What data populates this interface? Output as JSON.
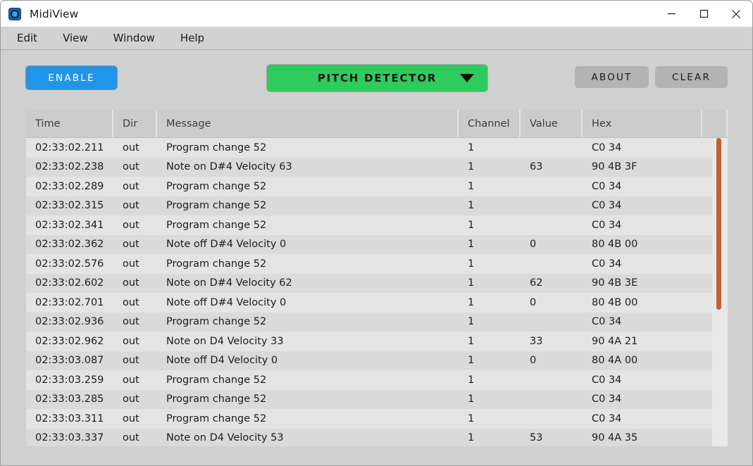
{
  "window": {
    "title": "MidiView",
    "icon": "midi-din-icon",
    "controls": {
      "minimize": "minimize-icon",
      "maximize": "maximize-icon",
      "close": "close-icon"
    }
  },
  "menubar": {
    "items": [
      {
        "label": "Edit"
      },
      {
        "label": "View"
      },
      {
        "label": "Window"
      },
      {
        "label": "Help"
      }
    ]
  },
  "toolbar": {
    "enable_label": "ENABLE",
    "enable_color": "#2196e8",
    "device_label": "PITCH DETECTOR",
    "device_color": "#2ecc5d",
    "dropdown_icon": "chevron-down-icon",
    "about_label": "ABOUT",
    "clear_label": "CLEAR",
    "button_color": "#b3b3b3"
  },
  "table": {
    "columns": [
      "Time",
      "Dir",
      "Message",
      "Channel",
      "Value",
      "Hex",
      ""
    ],
    "rows": [
      {
        "time": "02:33:02.211",
        "dir": "out",
        "message": "Program change 52",
        "channel": "1",
        "value": "",
        "hex": "C0 34"
      },
      {
        "time": "02:33:02.238",
        "dir": "out",
        "message": "Note on D#4 Velocity 63",
        "channel": "1",
        "value": "63",
        "hex": "90 4B 3F"
      },
      {
        "time": "02:33:02.289",
        "dir": "out",
        "message": "Program change 52",
        "channel": "1",
        "value": "",
        "hex": "C0 34"
      },
      {
        "time": "02:33:02.315",
        "dir": "out",
        "message": "Program change 52",
        "channel": "1",
        "value": "",
        "hex": "C0 34"
      },
      {
        "time": "02:33:02.341",
        "dir": "out",
        "message": "Program change 52",
        "channel": "1",
        "value": "",
        "hex": "C0 34"
      },
      {
        "time": "02:33:02.362",
        "dir": "out",
        "message": "Note off D#4 Velocity 0",
        "channel": "1",
        "value": "0",
        "hex": "80 4B 00"
      },
      {
        "time": "02:33:02.576",
        "dir": "out",
        "message": "Program change 52",
        "channel": "1",
        "value": "",
        "hex": "C0 34"
      },
      {
        "time": "02:33:02.602",
        "dir": "out",
        "message": "Note on D#4 Velocity 62",
        "channel": "1",
        "value": "62",
        "hex": "90 4B 3E"
      },
      {
        "time": "02:33:02.701",
        "dir": "out",
        "message": "Note off D#4 Velocity 0",
        "channel": "1",
        "value": "0",
        "hex": "80 4B 00"
      },
      {
        "time": "02:33:02.936",
        "dir": "out",
        "message": "Program change 52",
        "channel": "1",
        "value": "",
        "hex": "C0 34"
      },
      {
        "time": "02:33:02.962",
        "dir": "out",
        "message": "Note on D4 Velocity 33",
        "channel": "1",
        "value": "33",
        "hex": "90 4A 21"
      },
      {
        "time": "02:33:03.087",
        "dir": "out",
        "message": "Note off D4 Velocity 0",
        "channel": "1",
        "value": "0",
        "hex": "80 4A 00"
      },
      {
        "time": "02:33:03.259",
        "dir": "out",
        "message": "Program change 52",
        "channel": "1",
        "value": "",
        "hex": "C0 34"
      },
      {
        "time": "02:33:03.285",
        "dir": "out",
        "message": "Program change 52",
        "channel": "1",
        "value": "",
        "hex": "C0 34"
      },
      {
        "time": "02:33:03.311",
        "dir": "out",
        "message": "Program change 52",
        "channel": "1",
        "value": "",
        "hex": "C0 34"
      },
      {
        "time": "02:33:03.337",
        "dir": "out",
        "message": "Note on D4 Velocity 53",
        "channel": "1",
        "value": "53",
        "hex": "90 4A 35"
      }
    ],
    "scrollbar_color": "#c2622f"
  }
}
